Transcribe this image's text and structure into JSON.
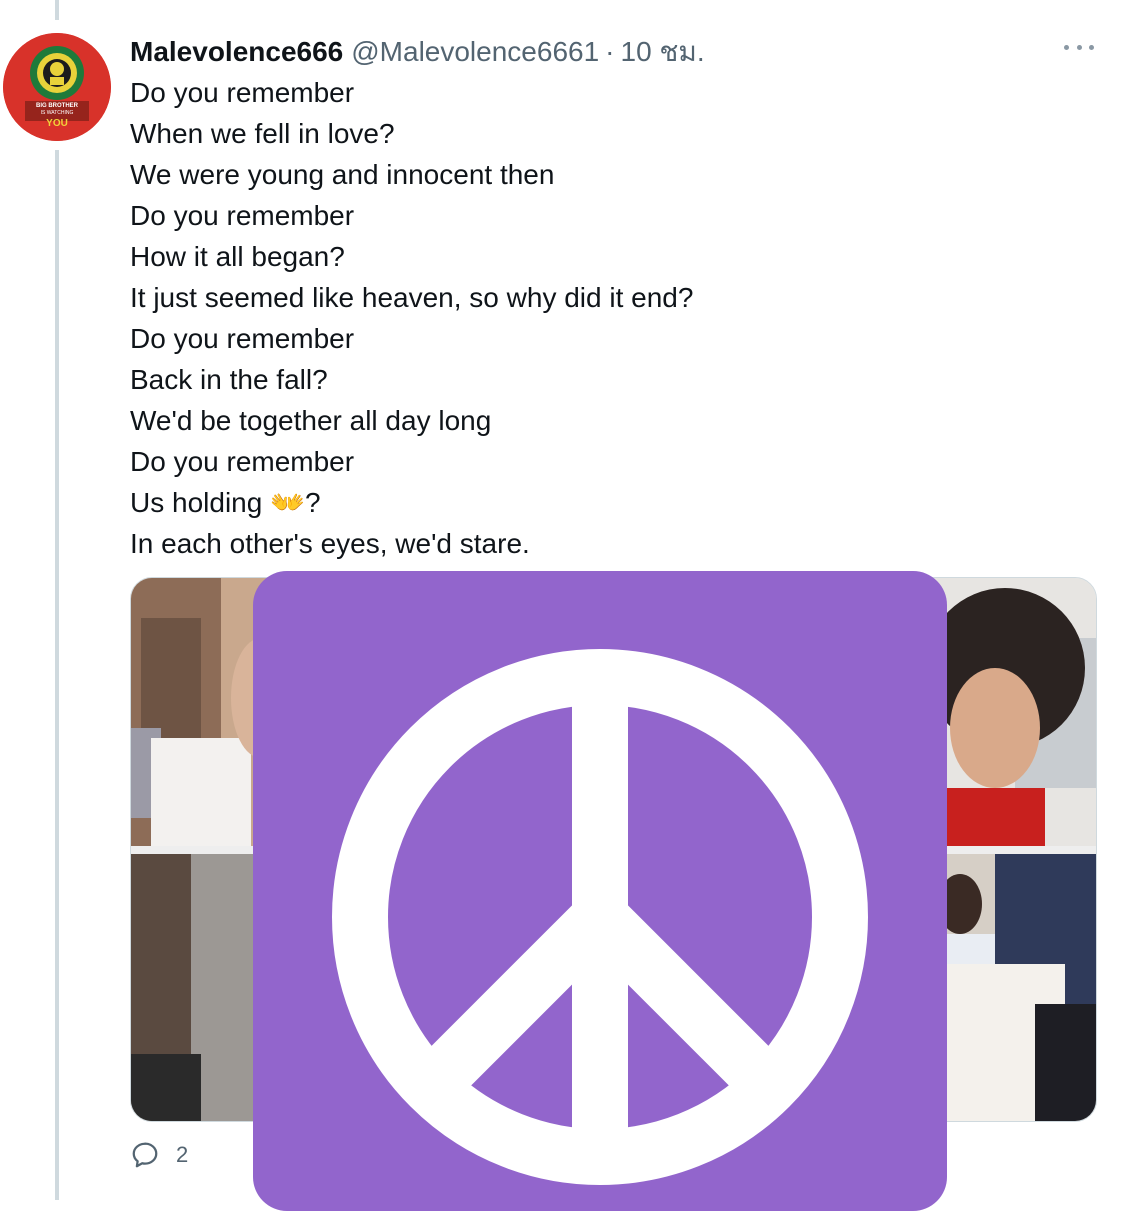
{
  "tweet": {
    "display_name": "Malevolence666",
    "handle": "@Malevolence6661",
    "separator": "·",
    "timestamp": "10 ชม.",
    "lines": [
      "Do you remember",
      "When we fell in love?",
      "We were young and innocent then",
      "Do you remember",
      "How it all began?",
      "It just seemed like heaven, so why did it end?",
      "Do you remember",
      "Back in the fall?",
      "We'd be together all day long",
      "Do you remember",
      "Us holding 👐?",
      "In each other's eyes, we'd stare."
    ],
    "reply_count": "2"
  },
  "avatar": {
    "text_line1": "BIG BROTHER",
    "text_line2": "IS WATCHING",
    "text_line3": "YOU"
  },
  "colors": {
    "overlay": "#9265cc",
    "avatar_bg": "#d8322a",
    "secondary_text": "#536471"
  },
  "icons": {
    "more": "more-dots-icon",
    "reply": "reply-icon",
    "overlay": "peace-sign-icon"
  }
}
